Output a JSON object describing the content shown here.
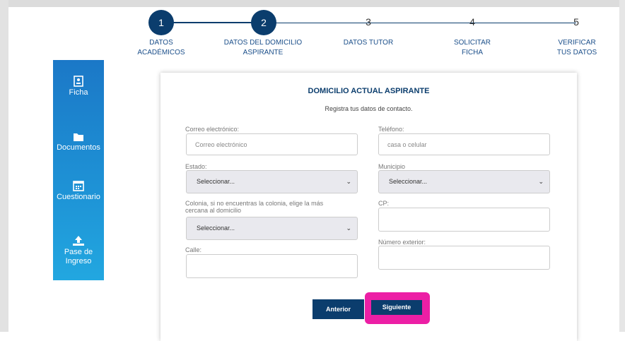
{
  "stepper": {
    "steps": [
      {
        "number": "1",
        "label_line1": "DATOS",
        "label_line2": "ACADÉMICOS"
      },
      {
        "number": "2",
        "label_line1": "DATOS DEL DOMICILIO",
        "label_line2": "ASPIRANTE"
      },
      {
        "number": "3",
        "label_line1": "DATOS TUTOR",
        "label_line2": ""
      },
      {
        "number": "4",
        "label_line1": "SOLICITAR",
        "label_line2": "FICHA"
      },
      {
        "number": "5",
        "label_line1": "VERIFICAR",
        "label_line2": "TUS DATOS"
      }
    ],
    "active_color": "#0b3d6d"
  },
  "sidebar": {
    "items": [
      {
        "label": "Ficha",
        "icon": "id-card-icon"
      },
      {
        "label": "Documentos",
        "icon": "folder-icon"
      },
      {
        "label": "Cuestionario",
        "icon": "calendar-icon"
      },
      {
        "label_line1": "Pase de",
        "label_line2": "Ingreso",
        "icon": "upload-tray-icon"
      }
    ]
  },
  "form": {
    "title": "DOMICILIO ACTUAL ASPIRANTE",
    "subtitle": "Registra tus datos de contacto.",
    "email": {
      "label": "Correo electrónico:",
      "placeholder": "Correo electrónico",
      "value": ""
    },
    "phone": {
      "label": "Teléfono:",
      "placeholder": "casa o celular",
      "value": ""
    },
    "state": {
      "label": "Estado:",
      "selected": "Seleccionar..."
    },
    "municipality": {
      "label": "Municipio",
      "selected": "Seleccionar..."
    },
    "colony": {
      "label_line1": "Colonia, si no encuentras la colonia, elige la más",
      "label_line2": "cercana al domicilio",
      "selected": "Seleccionar..."
    },
    "cp": {
      "label": "CP:",
      "value": ""
    },
    "street": {
      "label": "Calle:",
      "value": ""
    },
    "ext_number": {
      "label": "Número exterior:",
      "value": ""
    },
    "buttons": {
      "prev": "Anterior",
      "next": "Siguiente"
    },
    "highlight_color": "#ec1fa5"
  }
}
